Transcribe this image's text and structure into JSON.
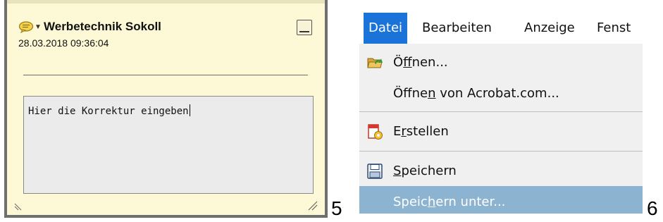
{
  "comment_popup": {
    "author": "Werbetechnik Sokoll",
    "timestamp": "28.03.2018 09:36:04",
    "text": "Hier die Korrektur eingeben"
  },
  "figure_labels": {
    "left": "5",
    "right": "6"
  },
  "menu": {
    "menubar": [
      "Datei",
      "Bearbeiten",
      "Anzeige",
      "Fenst"
    ],
    "items": [
      {
        "pre": "Ö",
        "key": "f",
        "post": "fnen...",
        "icon": "open-folder-icon"
      },
      {
        "pre": "Öffne",
        "key": "n",
        "post": " von Acrobat.com..."
      },
      {
        "pre": "E",
        "key": "r",
        "post": "stellen",
        "icon": "create-pdf-icon"
      },
      {
        "pre": "",
        "key": "S",
        "post": "peichern",
        "icon": "floppy-disk-icon"
      },
      {
        "pre": "Speic",
        "key": "h",
        "post": "ern unter..."
      }
    ]
  },
  "colors": {
    "popup_bg": "#fdf9d7",
    "menu_highlight": "#1a73d9",
    "item_hover": "#8cb3cf"
  }
}
